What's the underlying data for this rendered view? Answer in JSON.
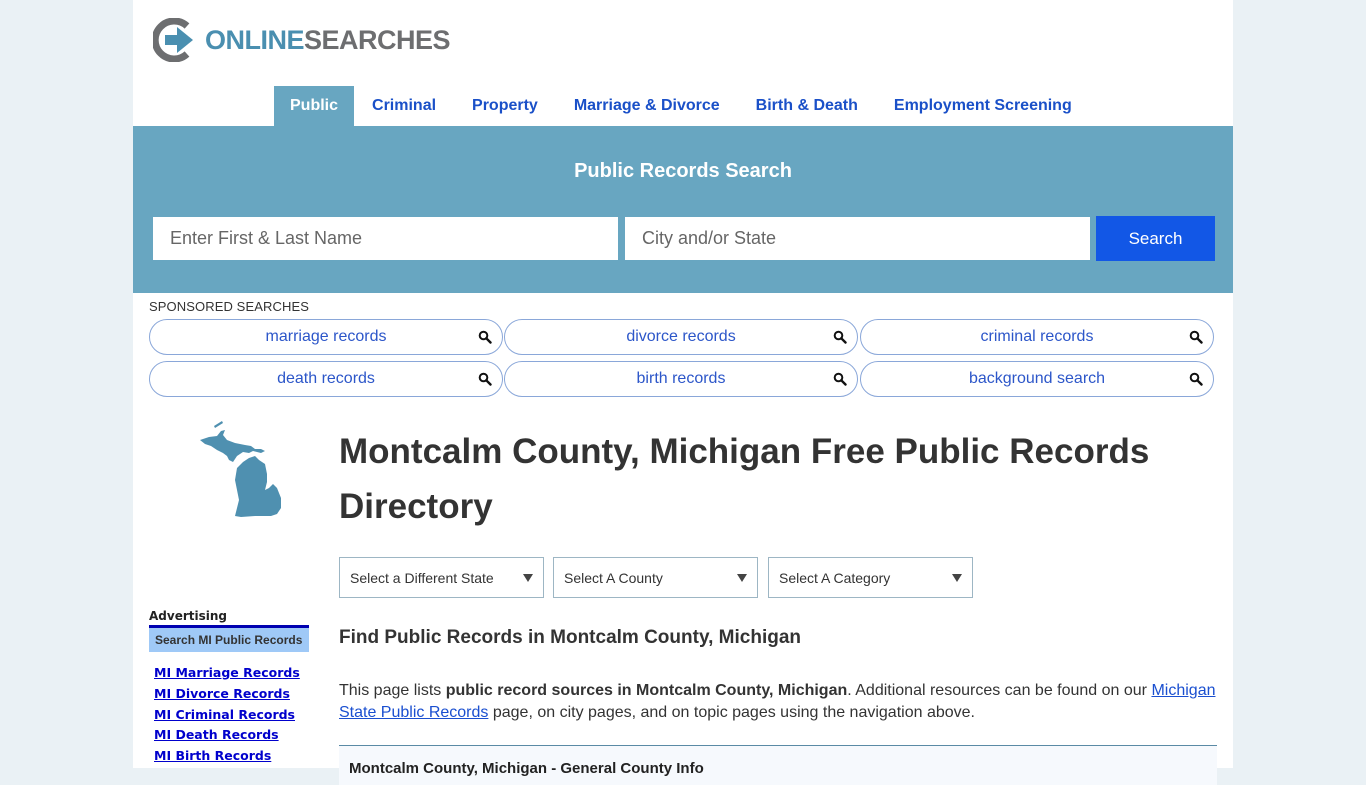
{
  "brand": {
    "name_part1": "ONLINE",
    "name_part2": "SEARCHES",
    "logo_icon": "arrow-circle-logo-icon",
    "colors": {
      "primary": "#68a6c1",
      "accent_blue": "#1257e6",
      "logo_gray": "#6d6e70",
      "logo_blue": "#4a8fb0"
    }
  },
  "nav": {
    "items": [
      {
        "label": "Public",
        "active": true
      },
      {
        "label": "Criminal",
        "active": false
      },
      {
        "label": "Property",
        "active": false
      },
      {
        "label": "Marriage & Divorce",
        "active": false
      },
      {
        "label": "Birth & Death",
        "active": false
      },
      {
        "label": "Employment Screening",
        "active": false
      }
    ]
  },
  "search": {
    "title": "Public Records Search",
    "name_placeholder": "Enter First & Last Name",
    "name_value": "",
    "location_placeholder": "City and/or State",
    "location_value": "",
    "button_label": "Search"
  },
  "sponsored": {
    "label": "SPONSORED SEARCHES",
    "icon": "magnifier-icon",
    "items": [
      {
        "label": "marriage records"
      },
      {
        "label": "divorce records"
      },
      {
        "label": "criminal records"
      },
      {
        "label": "death records"
      },
      {
        "label": "birth records"
      },
      {
        "label": "background search"
      }
    ]
  },
  "sidebar": {
    "map_icon": "michigan-state-map",
    "advertising_label": "Advertising",
    "box_title": "Search MI Public Records",
    "links": [
      {
        "label": "MI Marriage Records"
      },
      {
        "label": "MI Divorce Records"
      },
      {
        "label": "MI Criminal Records"
      },
      {
        "label": "MI Death Records"
      },
      {
        "label": "MI Birth Records"
      }
    ]
  },
  "main": {
    "title": "Montcalm County, Michigan Free Public Records Directory",
    "selects": [
      {
        "label": "Select a Different State"
      },
      {
        "label": "Select A County"
      },
      {
        "label": "Select A Category"
      }
    ],
    "sub_heading": "Find Public Records in Montcalm County, Michigan",
    "intro": {
      "text1": "This page lists ",
      "bold1": "public record sources in Montcalm County, Michigan",
      "text2": ". Additional resources can be found on our ",
      "link": "Michigan State Public Records",
      "text3": " page, on city pages, and on topic pages using the navigation above."
    },
    "info_box_title": "Montcalm County, Michigan - General County Info"
  }
}
